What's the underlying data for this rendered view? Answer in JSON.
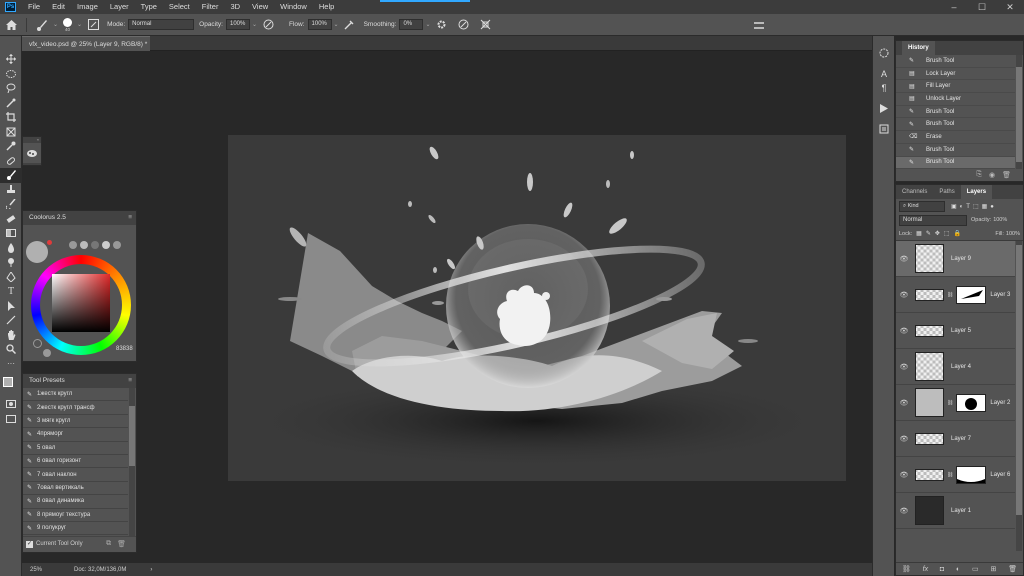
{
  "app": {
    "logo": "Ps",
    "menus": [
      "File",
      "Edit",
      "Image",
      "Layer",
      "Type",
      "Select",
      "Filter",
      "3D",
      "View",
      "Window",
      "Help"
    ],
    "window_controls": [
      "minimize-icon",
      "maximize-icon",
      "close-icon"
    ]
  },
  "options": {
    "brush_size": "40",
    "mode_label": "Mode:",
    "mode_value": "Normal",
    "opacity_label": "Opacity:",
    "opacity_value": "100%",
    "flow_label": "Flow:",
    "flow_value": "100%",
    "smoothing_label": "Smoothing:",
    "smoothing_value": "0%"
  },
  "document": {
    "tab_title": "vfx_video.psd @ 25% (Layer 9, RGB/8) *"
  },
  "status": {
    "zoom": "25%",
    "doc_size": "Doc: 32,0M/136,0M"
  },
  "coolorus": {
    "title": "Coolorus 2.5",
    "hex": "83838"
  },
  "presets": {
    "title": "Tool Presets",
    "items": [
      "1жестк кругл",
      "2жестк кругл трансф",
      "3 мягк кругл",
      "4пряморг",
      "5 овал",
      "6 овал горизонт",
      "7 овал наклон",
      "7овал вертикаль",
      "8 овал динамика",
      "8 прямоуг текстура",
      "9 полукруг"
    ],
    "current_only": "Current Tool Only"
  },
  "history": {
    "title": "History",
    "items": [
      "Brush Tool",
      "Lock Layer",
      "Fill Layer",
      "Unlock Layer",
      "Brush Tool",
      "Brush Tool",
      "Erase",
      "Brush Tool",
      "Brush Tool"
    ]
  },
  "layers": {
    "tabs": [
      "Channels",
      "Paths",
      "Layers"
    ],
    "kind": "Kind",
    "blend": "Normal",
    "opacity_label": "Opacity:",
    "opacity_value": "100%",
    "lock_label": "Lock:",
    "fill_label": "Fill:",
    "fill_value": "100%",
    "items": [
      {
        "name": "Layer 9"
      },
      {
        "name": "Layer 3"
      },
      {
        "name": "Layer 5"
      },
      {
        "name": "Layer 4"
      },
      {
        "name": "Layer 2"
      },
      {
        "name": "Layer 7"
      },
      {
        "name": "Layer 6"
      },
      {
        "name": "Layer 1"
      }
    ]
  },
  "colors": {
    "accent": "#31a8ff",
    "panel": "#535353",
    "canvas_bg": "#282828",
    "artboard": "#3a3a3a"
  }
}
